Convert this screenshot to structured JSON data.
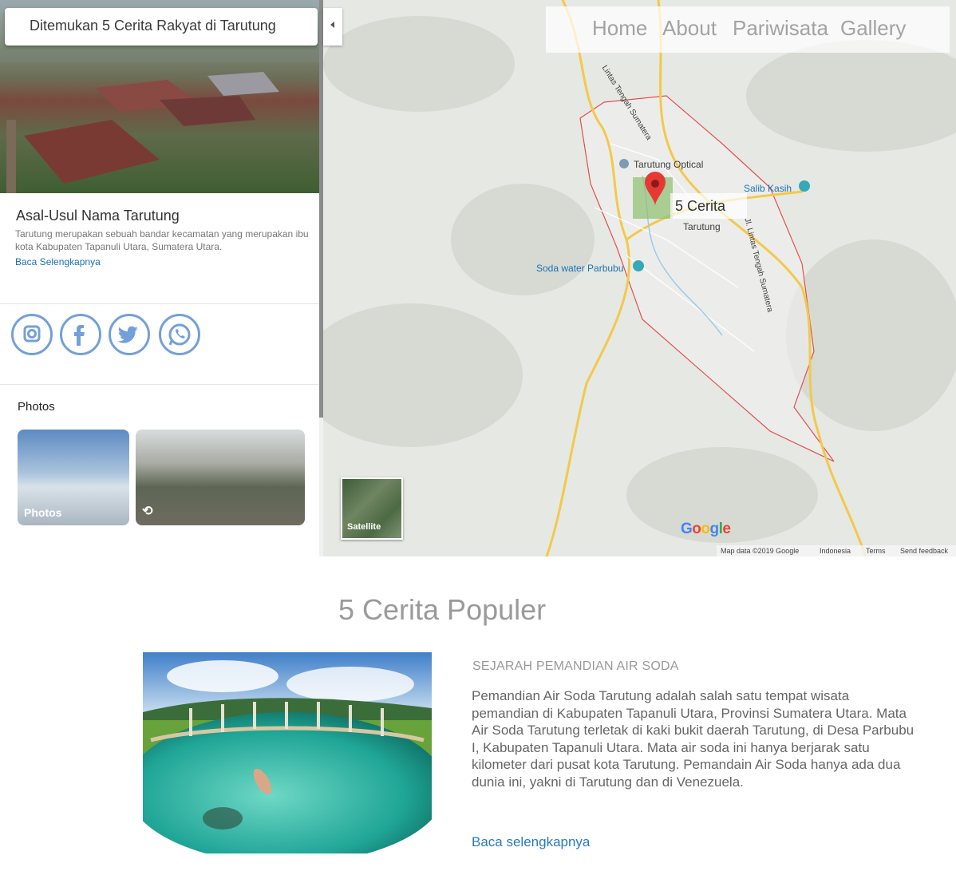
{
  "search": {
    "value": "Ditemukan 5 Cerita Rakyat di Tarutung"
  },
  "nav": {
    "home": "Home",
    "about": "About",
    "pariwisata": "Pariwisata",
    "gallery": "Gallery"
  },
  "place": {
    "title": "Asal-Usul Nama Tarutung",
    "description": "Tarutung merupakan sebuah bandar kecamatan yang merupakan ibu kota Kabupaten Tapanuli Utara, Sumatera Utara.",
    "more": "Baca Selengkapnya"
  },
  "social": [
    "instagram-icon",
    "facebook-icon",
    "twitter-icon",
    "whatsapp-icon"
  ],
  "photos": {
    "title": "Photos",
    "items": [
      {
        "label": "Photos"
      },
      {
        "label": ""
      }
    ]
  },
  "map": {
    "labels": {
      "road_north": "Lintas Tengah Sumatera",
      "optical": "Tarutung Optical",
      "salib": "Salib Kasih",
      "marker_title": "5 Cerita",
      "tarutung": "Tarutung",
      "soda": "Soda water Parbubu",
      "road_east": "Jl. Lintas Tengah Sumatera"
    },
    "satellite": "Satellite",
    "google": "Google",
    "footer": {
      "data": "Map data ©2019 Google",
      "region": "Indonesia",
      "terms": "Terms",
      "feedback": "Send feedback"
    }
  },
  "section": {
    "title": "5 Cerita Populer"
  },
  "article": {
    "heading": "SEJARAH PEMANDIAN AIR SODA",
    "body": "Pemandian Air Soda Tarutung adalah salah satu tempat wisata pemandian di Kabupaten Tapanuli Utara, Provinsi Sumatera Utara. Mata Air Soda Tarutung terletak di kaki bukit daerah Tarutung, di Desa Parbubu I, Kabupaten Tapanuli Utara. Mata air soda ini hanya berjarak satu kilometer dari pusat kota Tarutung. Pemandain Air Soda hanya ada dua dunia ini, yakni di Tarutung dan di Venezuela.",
    "more": "Baca selengkapnya"
  },
  "colors": {
    "accent": "#1a6fc0",
    "marker": "#e53935",
    "boundary": "#e05050",
    "road": "#f2c94c",
    "social": "#73a0d8"
  }
}
